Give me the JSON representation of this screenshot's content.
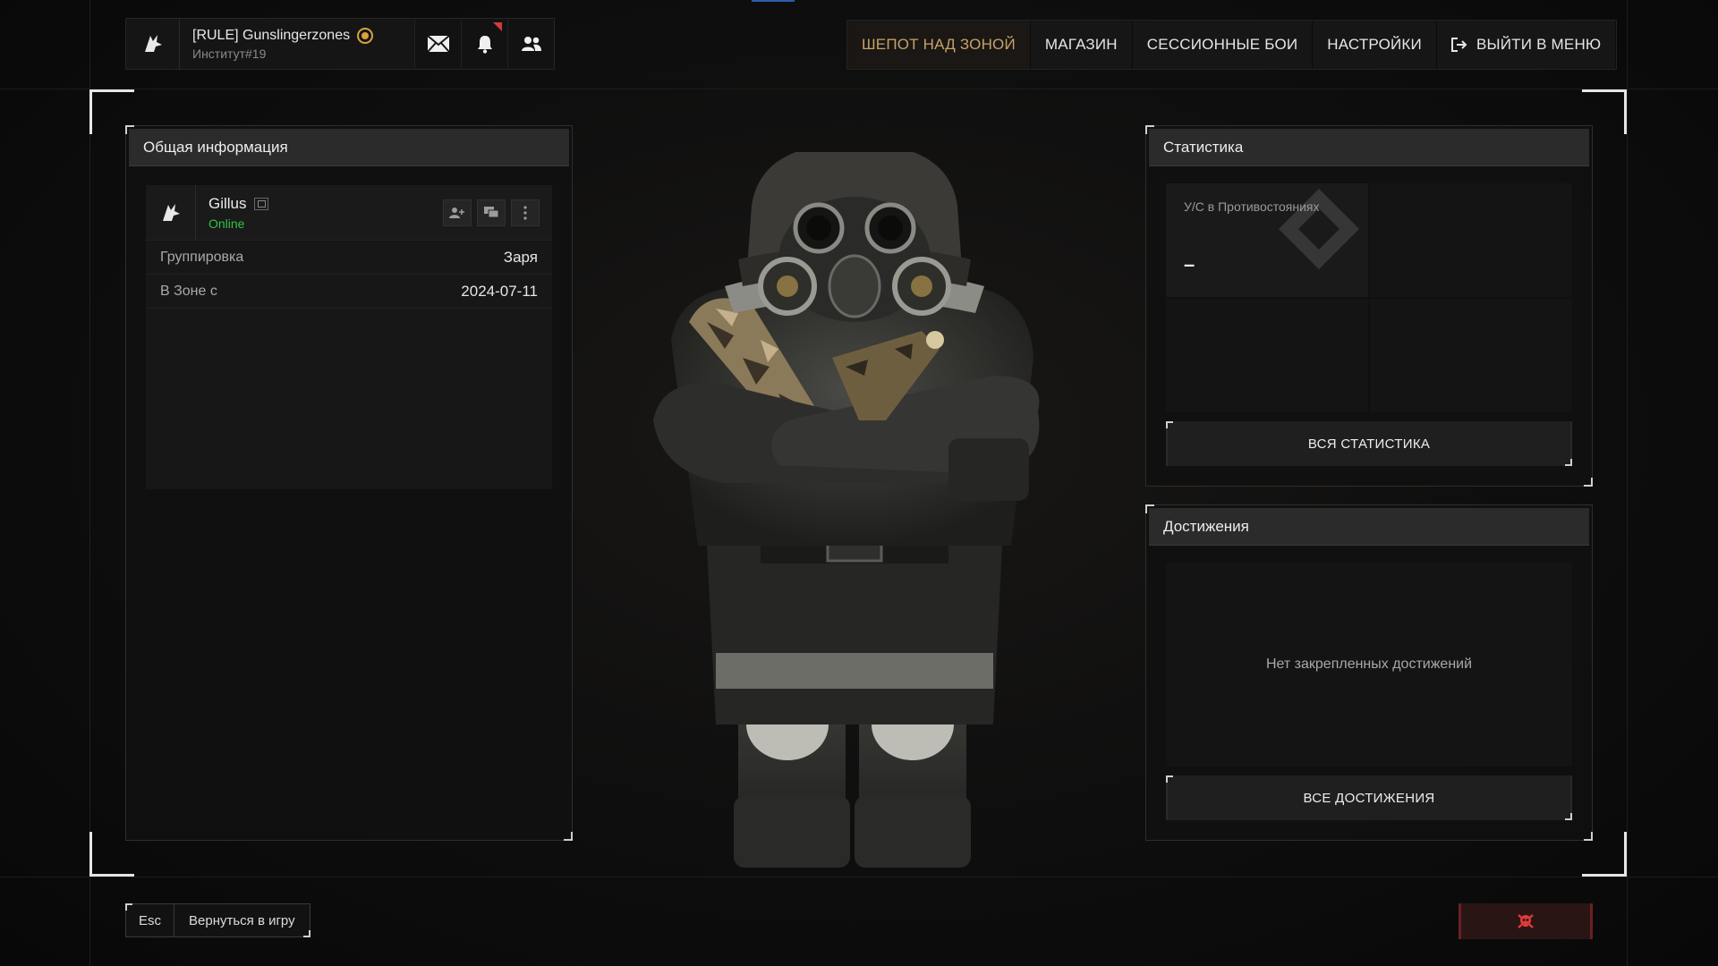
{
  "profile": {
    "name": "[RULE] Gunslingerzones",
    "subtitle": "Институт#19"
  },
  "top_icons": [
    "envelope-icon",
    "bell-icon",
    "friends-icon"
  ],
  "nav": {
    "items": [
      {
        "label": "ШЕПОТ НАД ЗОНОЙ",
        "active": true
      },
      {
        "label": "МАГАЗИН"
      },
      {
        "label": "СЕССИОННЫЕ БОИ"
      },
      {
        "label": "НАСТРОЙКИ"
      },
      {
        "label": "ВЫЙТИ В МЕНЮ",
        "icon": "exit-icon"
      }
    ]
  },
  "info_panel": {
    "title": "Общая информация",
    "user": {
      "name": "Gillus",
      "status": "Online"
    },
    "rows": [
      {
        "key": "Группировка",
        "value": "Заря"
      },
      {
        "key": "В Зоне с",
        "value": "2024-07-11"
      }
    ]
  },
  "stats_panel": {
    "title": "Статистика",
    "cells": [
      {
        "label": "У/С в Противостояниях",
        "value": "–"
      }
    ],
    "button_label": "ВСЯ СТАТИСТИКА"
  },
  "achievements_panel": {
    "title": "Достижения",
    "empty_text": "Нет закрепленных достижений",
    "button_label": "ВСЕ ДОСТИЖЕНИЯ"
  },
  "bottom": {
    "esc_key": "Esc",
    "esc_label": "Вернуться в игру"
  },
  "colors": {
    "accent_active": "#c7a26a",
    "online": "#31c24a",
    "danger": "#d23a3a"
  }
}
